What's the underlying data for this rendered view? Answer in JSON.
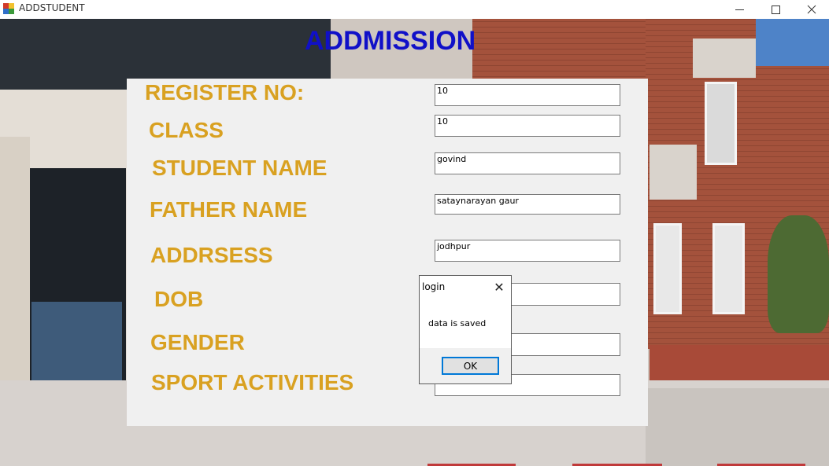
{
  "window": {
    "title": "ADDSTUDENT"
  },
  "form": {
    "heading": "ADDMISSION",
    "labels": {
      "register_no": "REGISTER NO:",
      "class": "CLASS",
      "student_name": "STUDENT NAME",
      "father_name": "FATHER NAME",
      "address": "ADDRSESS",
      "dob": "DOB",
      "gender": "GENDER",
      "sport_activities": "SPORT ACTIVITIES"
    },
    "values": {
      "register_no": "10",
      "class": "10",
      "student_name": "govind",
      "father_name": "sataynarayan gaur",
      "address": "jodhpur",
      "dob": "",
      "gender": "",
      "sport_activities": "football"
    },
    "label_color": "#d9a121",
    "heading_color": "#1010c8"
  },
  "dialog": {
    "title": "login",
    "message": "data is saved",
    "ok_label": "OK",
    "close_glyph": "✕"
  },
  "icons": {
    "app": "app-icon",
    "minimize": "minimize-icon",
    "maximize": "maximize-icon",
    "close": "close-icon"
  }
}
